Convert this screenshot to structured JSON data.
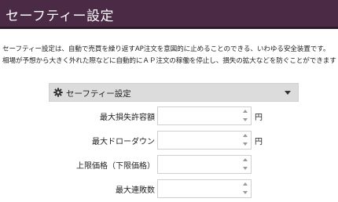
{
  "header": {
    "title": "セーフティー設定"
  },
  "description": {
    "line1": "セーフティー設定は、自動で売買を繰り返すAP注文を意図的に止めることのできる、いわゆる安全装置です。",
    "line2": "相場が予想から大きく外れた際などに自動的にＡＰ注文の稼働を停止し、損失の拡大などを防ぐことができます"
  },
  "panel": {
    "title": "セーフティー設定",
    "icon": "gear-icon",
    "rows": [
      {
        "label": "最大損失許容額",
        "value": "",
        "unit": "円"
      },
      {
        "label": "最大ドローダウン",
        "value": "",
        "unit": "円"
      },
      {
        "label": "上限価格（下限価格）",
        "value": "",
        "unit": ""
      },
      {
        "label": "最大連敗数",
        "value": "",
        "unit": ""
      }
    ]
  },
  "colors": {
    "header_bg": "#4a2a45",
    "panel_header_bg": "#dcdcdc"
  }
}
